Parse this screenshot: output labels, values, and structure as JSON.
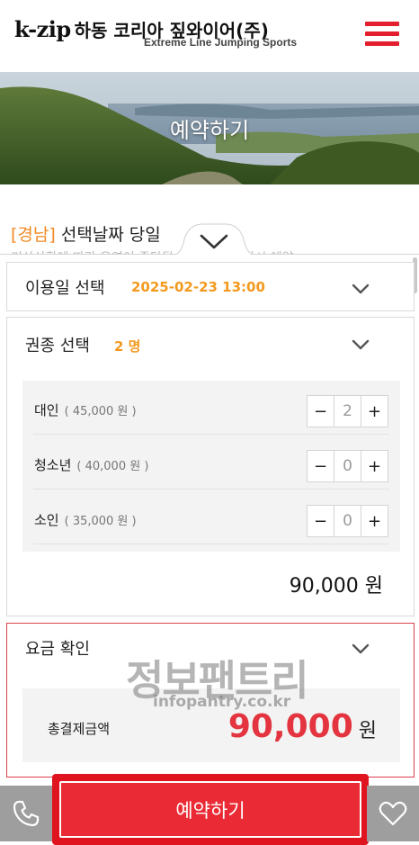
{
  "header": {
    "logo_main": "k-zip",
    "logo_kr": "하동 코리아 짚와이어(주)",
    "logo_sub": "Extreme Line Jumping Sports",
    "menu_icon": "hamburger-menu-icon"
  },
  "banner": {
    "title": "예약하기"
  },
  "background_content": {
    "region": "[경남]",
    "text": "선택날짜 당일",
    "faded_text": "기상상황에 따라 운영이 중단될 수 있으며 해당시 예약"
  },
  "date_section": {
    "label": "이용일 선택",
    "value": "2025-02-23 13:00"
  },
  "ticket_section": {
    "label": "권종 선택",
    "count": "2 명",
    "tickets": [
      {
        "name": "대인",
        "price": "( 45,000 원 )",
        "qty": "2"
      },
      {
        "name": "청소년",
        "price": "( 40,000 원 )",
        "qty": "0"
      },
      {
        "name": "소인",
        "price": "( 35,000 원 )",
        "qty": "0"
      }
    ],
    "total": "90,000 원",
    "minus": "−",
    "plus": "+"
  },
  "fee_section": {
    "label": "요금 확인",
    "total_label": "총결제금액",
    "amount": "90,000",
    "unit": "원"
  },
  "watermark": {
    "main": "정보팬트리",
    "sub": "infopantry.co.kr"
  },
  "bottom_bar": {
    "reserve_label": "예약하기",
    "phone_icon": "phone-icon",
    "heart_icon": "heart-icon"
  },
  "colors": {
    "accent_red": "#e0141e",
    "value_orange": "#f39a1e",
    "amount_red": "#e3343f"
  }
}
